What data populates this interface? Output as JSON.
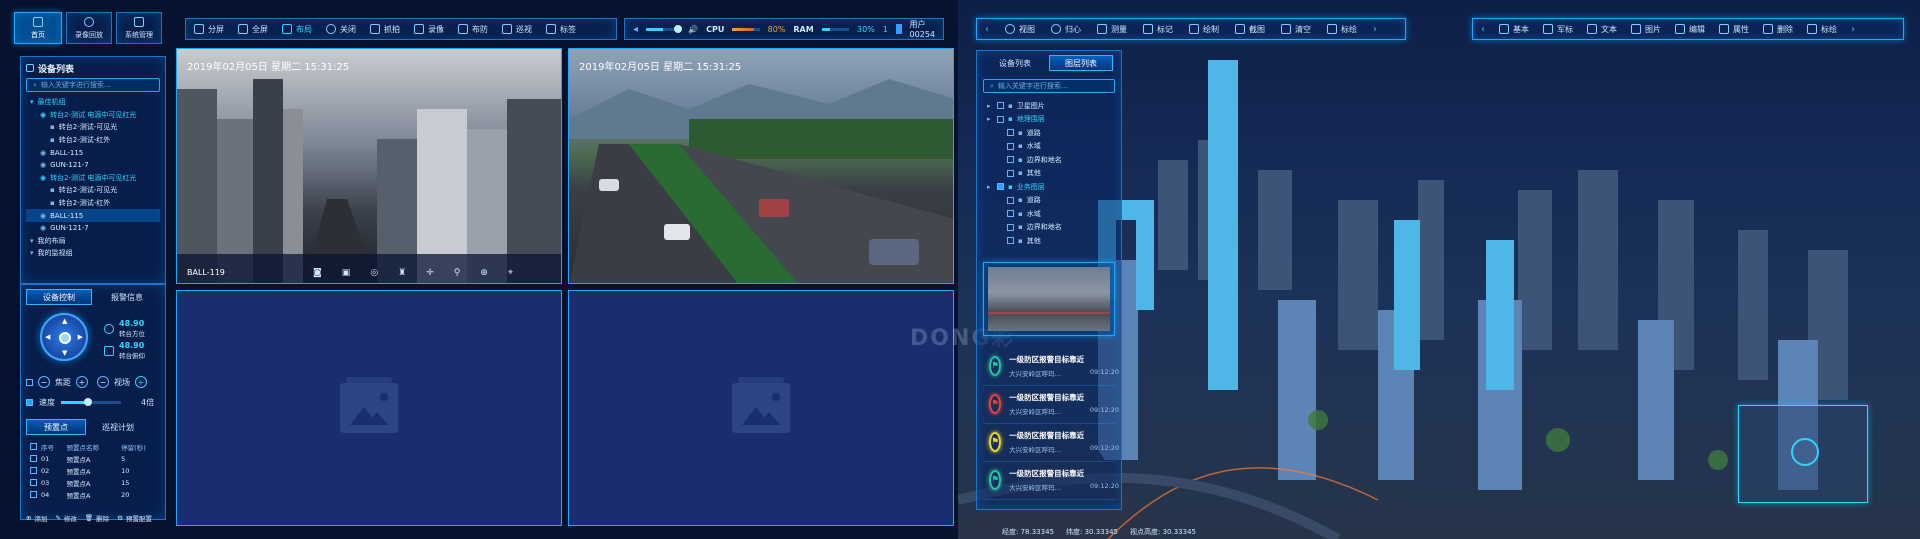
{
  "top_nav": {
    "tabs": [
      {
        "label": "首页"
      },
      {
        "label": "录像回放"
      },
      {
        "label": "系统管理"
      }
    ]
  },
  "video_toolbar": {
    "items": [
      {
        "label": "分屏"
      },
      {
        "label": "全屏"
      },
      {
        "label": "布局"
      },
      {
        "label": "关闭"
      },
      {
        "label": "抓拍"
      },
      {
        "label": "录像"
      },
      {
        "label": "布防"
      },
      {
        "label": "巡视"
      },
      {
        "label": "标签"
      }
    ]
  },
  "status_bar": {
    "cpu_label": "CPU",
    "cpu_value": "80%",
    "cpu_level": 0.8,
    "ram_label": "RAM",
    "ram_value": "30%",
    "ram_level": 0.3,
    "user_count": "1",
    "user_name": "用户00254"
  },
  "device_list": {
    "title": "设备列表",
    "search_placeholder": "输入关键字进行搜索...",
    "tree": [
      {
        "label": "最佳机组",
        "level": 0,
        "style": "cyan"
      },
      {
        "label": "转台2-测试 电源中可见红光",
        "level": 1,
        "style": "cyan"
      },
      {
        "label": "转台2-测试-可见光",
        "level": 2,
        "style": ""
      },
      {
        "label": "转台2-测试-红外",
        "level": 2,
        "style": ""
      },
      {
        "label": "BALL-115",
        "level": 1,
        "style": ""
      },
      {
        "label": "GUN-121-7",
        "level": 1,
        "style": ""
      },
      {
        "label": "转台2-测试 电源中可见红光",
        "level": 1,
        "style": "cyan"
      },
      {
        "label": "转台2-测试-可见光",
        "level": 2,
        "style": ""
      },
      {
        "label": "转台2-测试-红外",
        "level": 2,
        "style": ""
      },
      {
        "label": "BALL-115",
        "level": 1,
        "style": "hl"
      },
      {
        "label": "GUN-121-7",
        "level": 1,
        "style": ""
      },
      {
        "label": "我的布局",
        "level": 0,
        "style": ""
      },
      {
        "label": "我的监视组",
        "level": 0,
        "style": ""
      }
    ]
  },
  "device_control": {
    "tabs": [
      {
        "label": "设备控制"
      },
      {
        "label": "报警信息"
      }
    ],
    "azimuth_value": "48.90",
    "azimuth_label": "转台方位",
    "pitch_value": "48.90",
    "pitch_label": "转台俯仰",
    "zoom_label": "焦距",
    "focus_label": "视场",
    "speed_label": "速度",
    "speed_value": "4倍",
    "speed_level": 0.45
  },
  "preset": {
    "tabs": [
      {
        "label": "预置点"
      },
      {
        "label": "巡视计划"
      }
    ],
    "columns": [
      "序号",
      "预置点名称",
      "停留(秒)"
    ],
    "rows": [
      [
        "01",
        "预置点A",
        "5"
      ],
      [
        "02",
        "预置点A",
        "10"
      ],
      [
        "03",
        "预置点A",
        "15"
      ],
      [
        "04",
        "预置点A",
        "20"
      ]
    ],
    "actions": [
      {
        "label": "添加"
      },
      {
        "label": "修改"
      },
      {
        "label": "删除"
      },
      {
        "label": "预置配置"
      }
    ]
  },
  "video_grid": {
    "cells": [
      {
        "timestamp": "2019年02月05日 星期二 15:31:25",
        "camera": "BALL-119"
      },
      {
        "timestamp": "2019年02月05日 星期二 15:31:25",
        "camera": ""
      }
    ]
  },
  "watermark": "DONG彩",
  "map_toolbar": {
    "items": [
      {
        "label": "视图"
      },
      {
        "label": "归心"
      },
      {
        "label": "测量"
      },
      {
        "label": "标记"
      },
      {
        "label": "绘制"
      },
      {
        "label": "截图"
      },
      {
        "label": "清空"
      },
      {
        "label": "标绘"
      }
    ]
  },
  "right_toolbar": {
    "items": [
      {
        "label": "基本"
      },
      {
        "label": "军标"
      },
      {
        "label": "文本"
      },
      {
        "label": "图片"
      },
      {
        "label": "编辑"
      },
      {
        "label": "属性"
      },
      {
        "label": "删除"
      },
      {
        "label": "标绘"
      }
    ]
  },
  "layer_panel": {
    "tabs": [
      {
        "label": "设备列表"
      },
      {
        "label": "图层列表"
      }
    ],
    "search_placeholder": "输入关键字进行搜索...",
    "layers": [
      {
        "label": "卫星图片",
        "level": 0,
        "checked": false,
        "style": ""
      },
      {
        "label": "地理围层",
        "level": 0,
        "checked": false,
        "style": "cyan"
      },
      {
        "label": "道路",
        "level": 1,
        "checked": false,
        "style": ""
      },
      {
        "label": "水域",
        "level": 1,
        "checked": false,
        "style": ""
      },
      {
        "label": "边界和地名",
        "level": 1,
        "checked": false,
        "style": ""
      },
      {
        "label": "其他",
        "level": 1,
        "checked": false,
        "style": ""
      },
      {
        "label": "业务图层",
        "level": 0,
        "checked": true,
        "style": "cyan"
      },
      {
        "label": "道路",
        "level": 1,
        "checked": false,
        "style": ""
      },
      {
        "label": "水域",
        "level": 1,
        "checked": false,
        "style": ""
      },
      {
        "label": "边界和地名",
        "level": 1,
        "checked": false,
        "style": ""
      },
      {
        "label": "其他",
        "level": 1,
        "checked": false,
        "style": ""
      }
    ]
  },
  "alarms": [
    {
      "title": "一级防区报警目标靠近",
      "location": "大兴安岭区呼玛...",
      "time": "09:12:20",
      "color": "#22c4a0"
    },
    {
      "title": "一级防区报警目标靠近",
      "location": "大兴安岭区呼玛...",
      "time": "09:12:20",
      "color": "#e0443a"
    },
    {
      "title": "一级防区报警目标靠近",
      "location": "大兴安岭区呼玛...",
      "time": "09:12:20",
      "color": "#e8d32a"
    },
    {
      "title": "一级防区报警目标靠近",
      "location": "大兴安岭区呼玛...",
      "time": "09:12:20",
      "color": "#22c4a0"
    }
  ],
  "coords": {
    "lon_label": "经度:",
    "lon_value": "78.33345",
    "lat_label": "纬度:",
    "lat_value": "30.33345",
    "alt_label": "视点高度:",
    "alt_value": "30.33345"
  },
  "colors": {
    "accent": "#1fa6ff",
    "cyan": "#2fd4ff",
    "panel_bg": "#0a2864"
  }
}
